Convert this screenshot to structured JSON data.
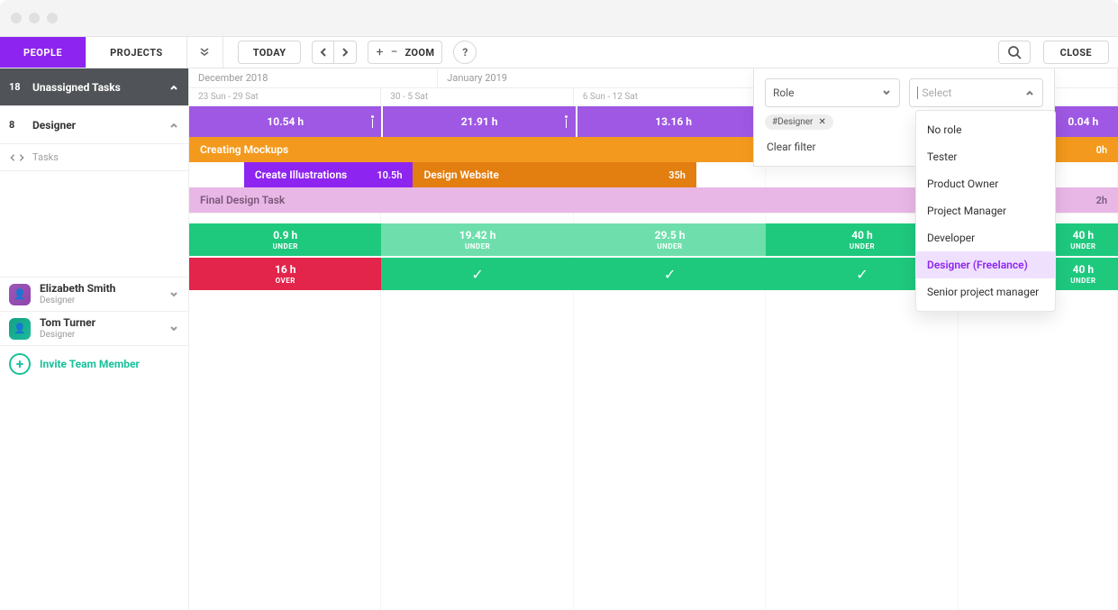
{
  "toolbar": {
    "tab_people": "PEOPLE",
    "tab_projects": "PROJECTS",
    "today": "TODAY",
    "zoom": "ZOOM",
    "close": "CLOSE"
  },
  "sidebar": {
    "unassigned": {
      "count": "18",
      "label": "Unassigned Tasks"
    },
    "designer": {
      "count": "8",
      "label": "Designer"
    },
    "tasks_label": "Tasks",
    "people": [
      {
        "name": "Elizabeth Smith",
        "role": "Designer"
      },
      {
        "name": "Tom Turner",
        "role": "Designer"
      }
    ],
    "invite": "Invite Team Member"
  },
  "timeline": {
    "months": [
      "December 2018",
      "January 2019"
    ],
    "weeks": [
      "23 Sun - 29 Sat",
      "30 - 5 Sat",
      "6 Sun - 12 Sat"
    ],
    "summary": [
      {
        "hours": "10.54 h",
        "left": "0%",
        "width": "20.7%",
        "handle": true
      },
      {
        "hours": "21.91 h",
        "left": "20.9%",
        "width": "20.7%",
        "handle": true
      },
      {
        "hours": "13.16 h",
        "left": "41.8%",
        "width": "20.7%",
        "handle": false
      },
      {
        "hours": "0.04 h",
        "left": "92.5%",
        "width": "7.5%",
        "handle": false
      }
    ],
    "tasks": [
      {
        "row": 0,
        "label": "Creating Mockups",
        "hours": "0h",
        "left": "0%",
        "width": "100%",
        "color": "#f39a1e",
        "right_hours": true
      },
      {
        "row": 1,
        "label": "Create Illustrations",
        "hours": "10.5h",
        "left": "5.9%",
        "width": "18.2%",
        "color": "#8e24ef",
        "right_hours": false
      },
      {
        "row": 1,
        "label": "Design Website",
        "hours": "35h",
        "left": "24.1%",
        "width": "30.5%",
        "color": "#e37e11",
        "right_hours": false
      },
      {
        "row": 2,
        "label": "Final Design Task",
        "hours": "2h",
        "left": "0%",
        "width": "100%",
        "color": "#e8b7e6",
        "right_hours": true,
        "dark_text": true
      }
    ],
    "capacity": [
      {
        "cells": [
          {
            "left": "0%",
            "width": "20.7%",
            "type": "green",
            "h": "0.9 h",
            "s": "UNDER"
          },
          {
            "left": "20.7%",
            "width": "20.7%",
            "type": "green-l",
            "h": "19.42 h",
            "s": "UNDER"
          },
          {
            "left": "41.4%",
            "width": "20.7%",
            "type": "green-l",
            "h": "29.5 h",
            "s": "UNDER"
          },
          {
            "left": "62.1%",
            "width": "20.7%",
            "type": "green",
            "h": "40 h",
            "s": "UNDER"
          },
          {
            "left": "92.5%",
            "width": "7.5%",
            "type": "green",
            "h": "40 h",
            "s": "UNDER"
          }
        ]
      },
      {
        "cells": [
          {
            "left": "0%",
            "width": "20.7%",
            "type": "red",
            "h": "16 h",
            "s": "OVER"
          },
          {
            "left": "20.7%",
            "width": "20.7%",
            "type": "green",
            "check": true
          },
          {
            "left": "41.4%",
            "width": "20.7%",
            "type": "green",
            "check": true
          },
          {
            "left": "62.1%",
            "width": "20.7%",
            "type": "green",
            "check": true
          },
          {
            "left": "92.5%",
            "width": "7.5%",
            "type": "green",
            "h": "40 h",
            "s": "UNDER"
          }
        ]
      }
    ]
  },
  "filter": {
    "category_label": "Role",
    "select_placeholder": "Select",
    "chip": "#Designer",
    "clear": "Clear filter",
    "options": [
      "No role",
      "Tester",
      "Product Owner",
      "Project Manager",
      "Developer",
      "Designer (Freelance)",
      "Senior project manager"
    ],
    "hover_index": 5
  }
}
